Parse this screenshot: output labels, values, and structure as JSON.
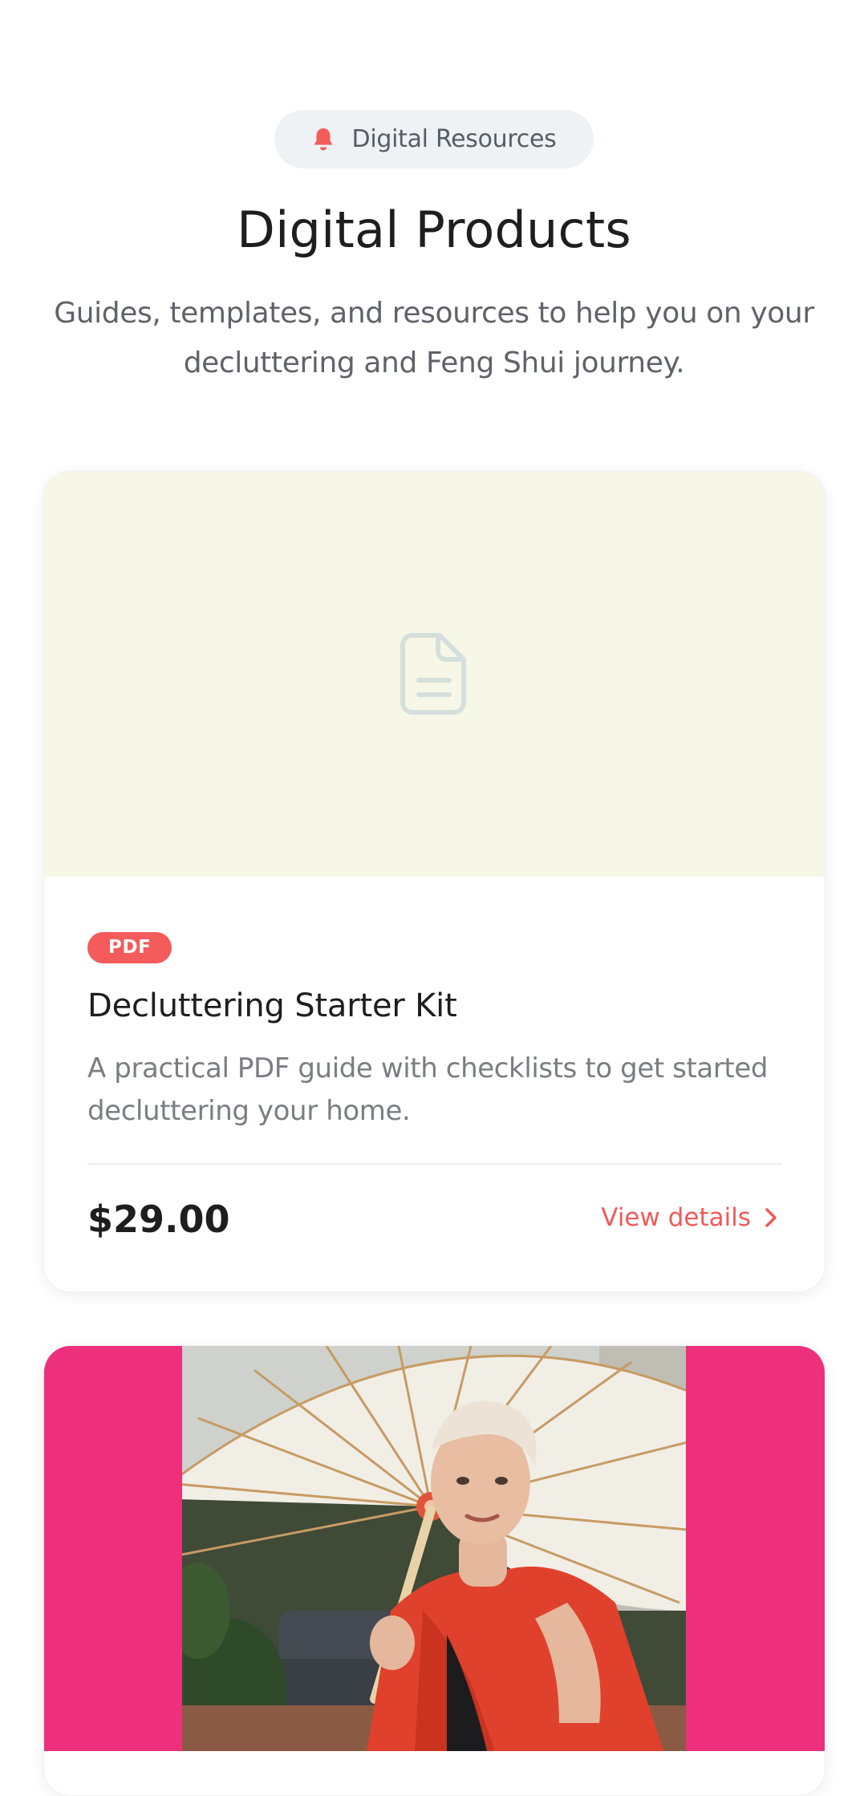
{
  "header": {
    "pill_label": "Digital Resources",
    "title": "Digital Products",
    "subtitle": "Guides, templates, and resources to help you on your decluttering and Feng Shui journey."
  },
  "products": [
    {
      "badge": "PDF",
      "title": "Decluttering Starter Kit",
      "description": "A practical PDF guide with checklists to get started decluttering your home.",
      "price": "$29.00",
      "link_label": "View details",
      "thumb_icon": "document-icon",
      "thumb_color": "#f7f7e7"
    },
    {
      "hero_color": "#ee2f7c",
      "image": "woman-with-paper-umbrella-photo"
    }
  ],
  "colors": {
    "accent": "#f45b5b",
    "link": "#ef5a5a",
    "pill_bg": "#eef2f4"
  }
}
